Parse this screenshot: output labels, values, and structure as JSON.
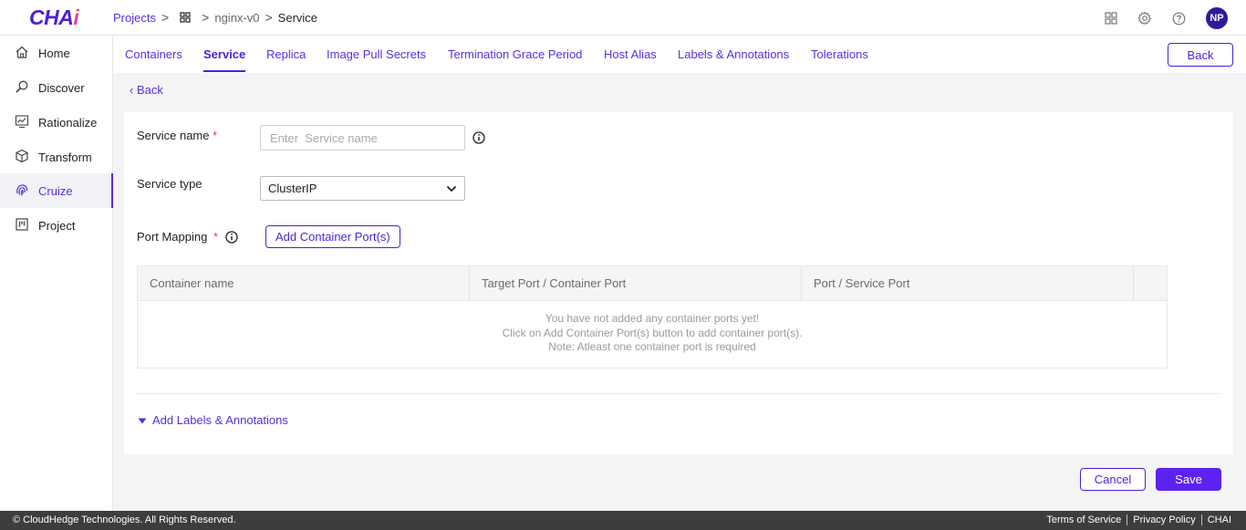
{
  "app": {
    "logo_text": "CHAI",
    "accent_color": "#4c1fd6",
    "save_color": "#5b22f2"
  },
  "breadcrumb": {
    "projects": "Projects",
    "sep": ">",
    "project": "nginx-v0",
    "current": "Service"
  },
  "user": {
    "initials": "NP"
  },
  "sidebar": {
    "items": [
      {
        "label": "Home",
        "icon": "home-icon"
      },
      {
        "label": "Discover",
        "icon": "search-icon"
      },
      {
        "label": "Rationalize",
        "icon": "chart-icon"
      },
      {
        "label": "Transform",
        "icon": "cube-icon"
      },
      {
        "label": "Cruize",
        "icon": "fingerprint-icon",
        "active": true
      },
      {
        "label": "Project",
        "icon": "board-icon"
      }
    ]
  },
  "tabs": [
    {
      "label": "Containers"
    },
    {
      "label": "Service",
      "active": true
    },
    {
      "label": "Replica"
    },
    {
      "label": "Image Pull Secrets"
    },
    {
      "label": "Termination Grace Period"
    },
    {
      "label": "Host Alias"
    },
    {
      "label": "Labels & Annotations"
    },
    {
      "label": "Tolerations"
    }
  ],
  "back_button": "Back",
  "back_link": "Back",
  "form": {
    "service_name_label": "Service name",
    "required_mark": "*",
    "service_name_placeholder": "Enter  Service name",
    "service_name_value": "",
    "service_type_label": "Service type",
    "service_type_value": "ClusterIP",
    "port_mapping_label": "Port Mapping",
    "add_port_button": "Add Container Port(s)"
  },
  "table": {
    "columns": [
      "Container name",
      "Target Port / Container Port",
      "Port / Service Port"
    ],
    "empty_lines": [
      "You have not added any container ports yet!",
      "Click on Add Container Port(s) button to add container port(s).",
      "Note: Atleast one container port is required"
    ]
  },
  "labels_toggle": "Add Labels & Annotations",
  "actions": {
    "cancel": "Cancel",
    "save": "Save"
  },
  "footer": {
    "copyright": "© CloudHedge Technologies. All Rights Reserved.",
    "links": [
      "Terms of Service",
      "Privacy Policy",
      "CHAI"
    ]
  }
}
